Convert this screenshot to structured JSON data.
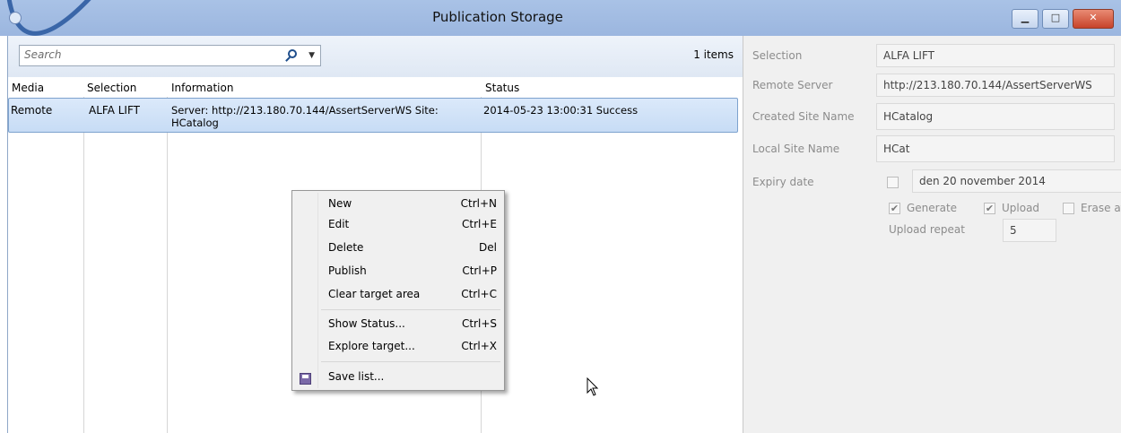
{
  "window": {
    "title": "Publication Storage",
    "buttons": {
      "minimize": "▁",
      "maximize": "□",
      "close": "✕"
    }
  },
  "list": {
    "search_placeholder": "Search",
    "item_count": "1 items",
    "columns": [
      "Media",
      "Selection",
      "Information",
      "Status"
    ],
    "rows": [
      {
        "media": "Remote",
        "selection": "ALFA LIFT",
        "information_line1": "Server: http://213.180.70.144/AssertServerWS Site:",
        "information_line2": "HCatalog",
        "status": "2014-05-23 13:00:31 Success"
      }
    ]
  },
  "context_menu": {
    "items": [
      {
        "label": "New",
        "shortcut": "Ctrl+N"
      },
      {
        "label": "Edit",
        "shortcut": "Ctrl+E"
      },
      {
        "label": "Delete",
        "shortcut": "Del"
      },
      {
        "label": "Publish",
        "shortcut": "Ctrl+P"
      },
      {
        "label": "Clear target area",
        "shortcut": "Ctrl+C"
      },
      {
        "label": "Show Status...",
        "shortcut": "Ctrl+S"
      },
      {
        "label": "Explore target...",
        "shortcut": "Ctrl+X"
      },
      {
        "label": "Save list...",
        "shortcut": ""
      }
    ]
  },
  "properties": {
    "selection": {
      "label": "Selection",
      "value": "ALFA LIFT"
    },
    "remote_server": {
      "label": "Remote Server",
      "value": "http://213.180.70.144/AssertServerWS"
    },
    "created_site_name": {
      "label": "Created Site Name",
      "value": "HCatalog"
    },
    "local_site_name": {
      "label": "Local Site Name",
      "value": "HCat"
    },
    "expiry_date": {
      "label": "Expiry date",
      "value": "den 20 november 2014",
      "checked": false
    },
    "generate": {
      "label": "Generate",
      "checked": true
    },
    "upload": {
      "label": "Upload",
      "checked": true
    },
    "erase": {
      "label": "Erase af",
      "checked": false
    },
    "upload_repeat": {
      "label": "Upload repeat",
      "value": "5"
    }
  }
}
